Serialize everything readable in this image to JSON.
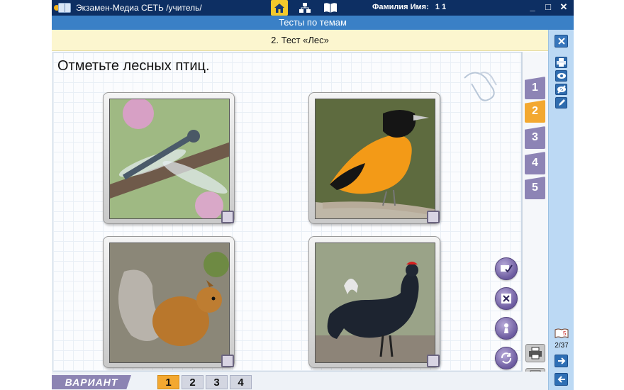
{
  "window": {
    "title": "Экзамен-Медиа СЕТЬ /учитель/",
    "user_label": "Фамилия Имя:",
    "user_name": "1 1",
    "minimize": "_",
    "maximize": "□",
    "close": "✕"
  },
  "section": {
    "title": "Тесты по темам"
  },
  "test": {
    "title": "2. Тест «Лес»"
  },
  "question": {
    "text": "Отметьте лесных птиц."
  },
  "answers": [
    {
      "subject": "dragonfly",
      "checked": false
    },
    {
      "subject": "oriole",
      "checked": false
    },
    {
      "subject": "squirrel",
      "checked": false
    },
    {
      "subject": "black-grouse",
      "checked": false
    }
  ],
  "question_tabs": [
    "1",
    "2",
    "3",
    "4",
    "5"
  ],
  "active_question_tab": "2",
  "progress": {
    "label": "2/37"
  },
  "variant": {
    "label": "ВАРИАНТ",
    "options": [
      "1",
      "2",
      "3",
      "4"
    ],
    "active": "1"
  },
  "colors": {
    "titlebar": "#0d2f63",
    "section": "#3a80c6",
    "test_bar": "#fcf6cf",
    "accent": "#f3a830",
    "tab": "#8d84b5"
  }
}
